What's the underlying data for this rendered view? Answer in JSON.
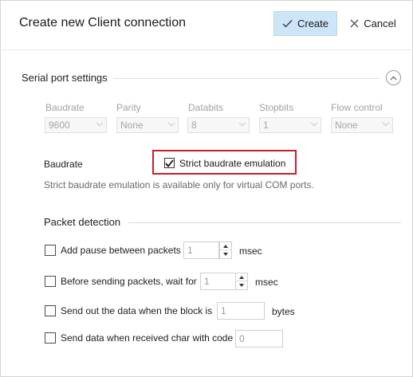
{
  "header": {
    "title": "Create new Client connection",
    "create_label": "Create",
    "cancel_label": "Cancel"
  },
  "serial": {
    "section_title": "Serial port settings",
    "params": [
      {
        "label": "Baudrate",
        "value": "9600"
      },
      {
        "label": "Parity",
        "value": "None"
      },
      {
        "label": "Databits",
        "value": "8"
      },
      {
        "label": "Stopbits",
        "value": "1"
      },
      {
        "label": "Flow control",
        "value": "None"
      }
    ],
    "baudrate_label": "Baudrate",
    "strict_label": "Strict baudrate emulation",
    "strict_checked": true,
    "note": "Strict baudrate emulation is available only for virtual COM ports."
  },
  "packet": {
    "section_title": "Packet detection",
    "options": [
      {
        "label": "Add pause between packets",
        "value": "1",
        "unit": "msec",
        "checked": false
      },
      {
        "label": "Before sending packets, wait for",
        "value": "1",
        "unit": "msec",
        "checked": false
      },
      {
        "label": "Send out the data when the block is",
        "value": "1",
        "unit": "bytes",
        "checked": false
      },
      {
        "label": "Send data when received char with code",
        "value": "0",
        "unit": "",
        "checked": false
      }
    ]
  },
  "colors": {
    "accent_button": "#cde6f7",
    "highlight_border": "#c5212a",
    "disabled_text": "#a6a6a6"
  }
}
